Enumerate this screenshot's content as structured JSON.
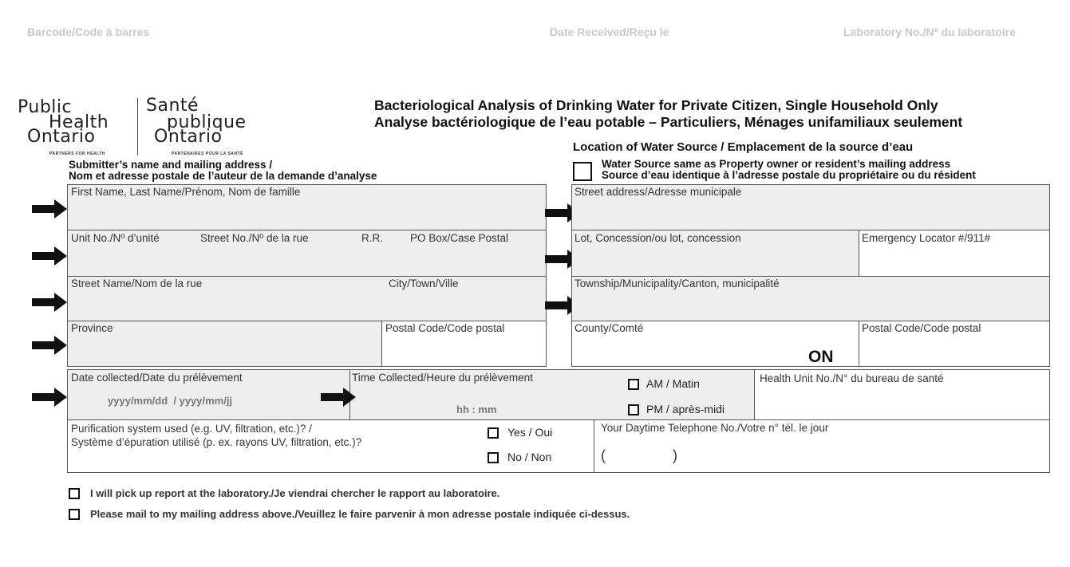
{
  "header": {
    "barcode_label": "Barcode/Code à barres",
    "date_received_label": "Date Received/Reçu le",
    "lab_no_label": "Laboratory No./Nº du laboratoire"
  },
  "logo": {
    "en_line1": "Public",
    "en_line2": "Health",
    "en_line3": "Ontario",
    "en_tagline": "PARTNERS FOR HEALTH",
    "fr_line1": "Santé",
    "fr_line2": "publique",
    "fr_line3": "Ontario",
    "fr_tagline": "PARTENAIRES POUR LA SANTÉ"
  },
  "title": {
    "en": "Bacteriological Analysis of Drinking Water for Private Citizen, Single Household Only",
    "fr": "Analyse bactériologique de l’eau potable – Particuliers, Ménages unifamiliaux seulement"
  },
  "submitter": {
    "heading_en": "Submitter’s name and mailing address /",
    "heading_fr": "Nom et adresse postale de l’auteur de la demande d’analyse",
    "name_label": "First Name, Last Name/Prénom, Nom de famille",
    "unit_label": "Unit No./Nº d’unité",
    "street_no_label": "Street No./Nº de la rue",
    "rr_label": "R.R.",
    "po_box_label": "PO Box/Case Postal",
    "street_name_label": "Street Name/Nom de la rue",
    "city_label": "City/Town/Ville",
    "province_label": "Province",
    "postal_label": "Postal Code/Code postal"
  },
  "water_source": {
    "heading": "Location of Water Source / Emplacement de la source d’eau",
    "same_checkbox_en": "Water Source same as Property owner or resident’s mailing address",
    "same_checkbox_fr": "Source d’eau identique à l’adresse postale du propriétaire ou du résident",
    "same_checked": false,
    "street_label": "Street address/Adresse municipale",
    "lot_label": "Lot, Concession/ou lot, concession",
    "emergency_label": "Emergency Locator #/911#",
    "township_label": "Township/Municipality/Canton, municipalité",
    "county_label": "County/Comté",
    "province_value": "ON",
    "postal_label": "Postal Code/Code postal"
  },
  "collection": {
    "date_label": "Date collected/Date du prélèvement",
    "date_placeholder": "yyyy/mm/dd  / yyyy/mm/jj",
    "time_label": "Time Collected/Heure du prélèvement",
    "time_placeholder": "hh : mm",
    "am_label": "AM / Matin",
    "pm_label": "PM / après-midi",
    "health_unit_label": "Health Unit No./N° du bureau de santé"
  },
  "purification": {
    "question_en": "Purification system used (e.g. UV, filtration, etc.)? /",
    "question_fr": "Système d’épuration utilisé (p. ex. rayons UV, filtration, etc.)?",
    "yes_label": "Yes / Oui",
    "no_label": "No / Non",
    "phone_label": "Your Daytime Telephone No./Votre n° tél. le jour",
    "phone_open": "(",
    "phone_close": ")"
  },
  "report": {
    "pickup_label": "I will pick up report at the laboratory./Je viendrai chercher le rapport au laboratoire.",
    "mail_label": "Please mail to my mailing address above./Veuillez le faire parvenir à mon adresse postale indiquée ci-dessus."
  }
}
